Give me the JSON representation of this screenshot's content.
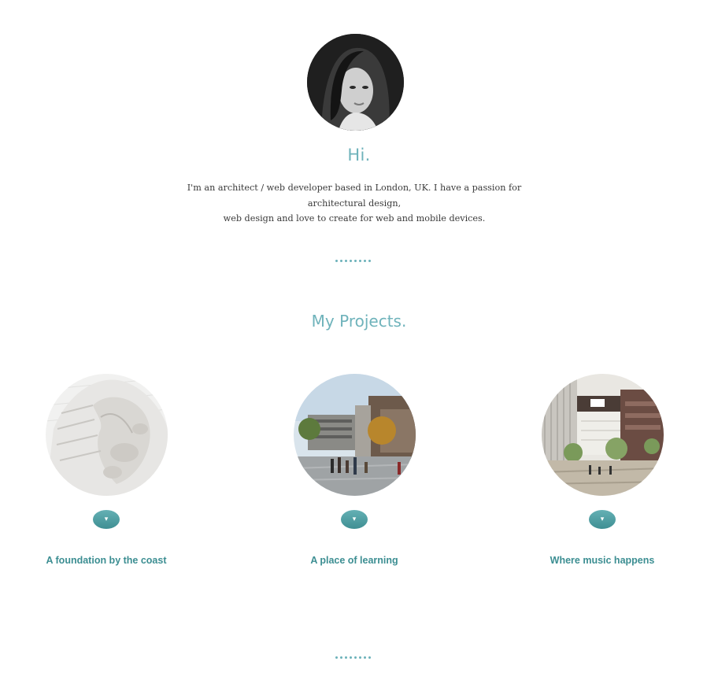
{
  "intro": {
    "heading": "Hi.",
    "line1": "I'm an architect / web developer based in London, UK. I have a passion for architectural design,",
    "line2": "web design and love to create for web and mobile devices."
  },
  "projects": {
    "heading": "My Projects.",
    "items": [
      {
        "title": "A foundation by the coast",
        "toggle_icon": "▾"
      },
      {
        "title": "A place of learning",
        "toggle_icon": "▾"
      },
      {
        "title": "Where music happens",
        "toggle_icon": "▾"
      }
    ]
  },
  "colors": {
    "accent": "#6fb3bb",
    "link": "#3c8e92",
    "body_text": "#3a3a3a"
  }
}
